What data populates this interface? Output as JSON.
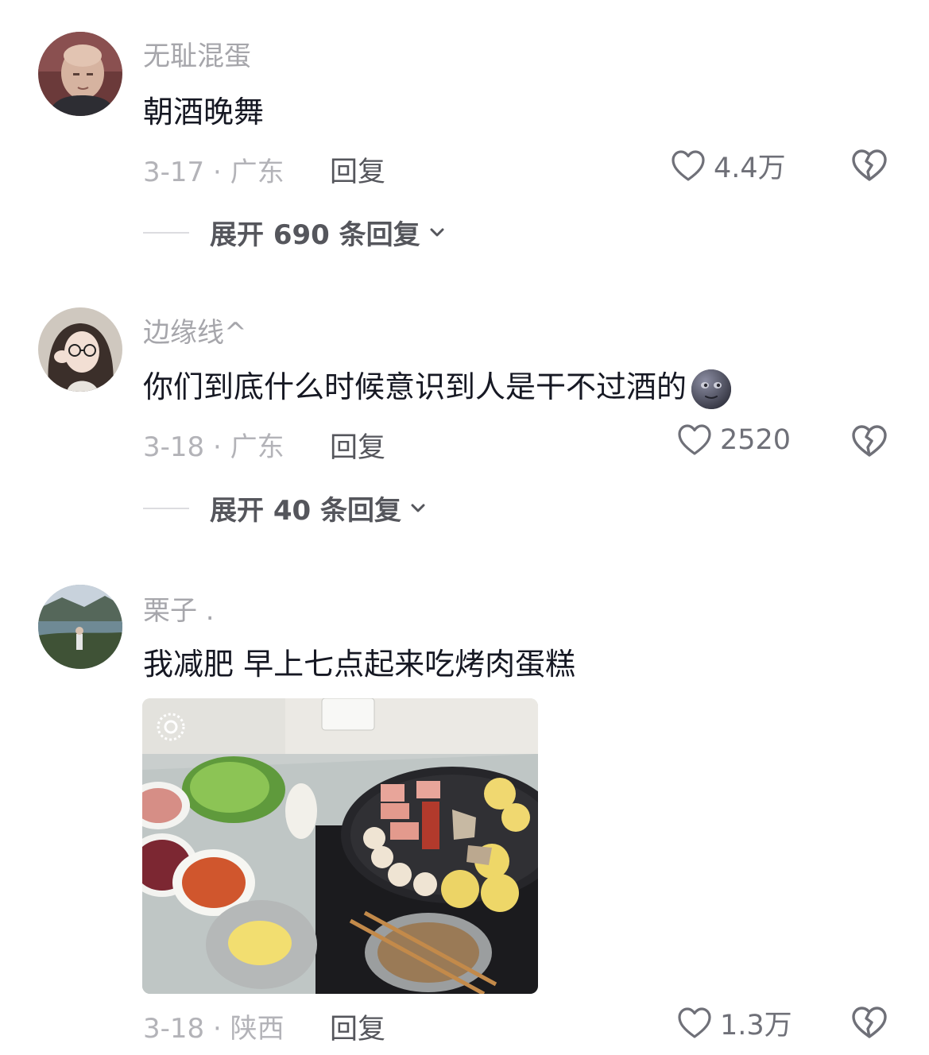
{
  "comments": [
    {
      "username": "无耻混蛋",
      "text": "朝酒晚舞",
      "meta": "3-17 · 广东",
      "reply_label": "回复",
      "likes": "4.4万",
      "expand_label": "展开 690 条回复"
    },
    {
      "username": "边缘线^",
      "text": "你们到底什么时候意识到人是干不过酒的",
      "emoji": "new-moon-face-emoji",
      "meta": "3-18 · 广东",
      "reply_label": "回复",
      "likes": "2520",
      "expand_label": "展开 40 条回复"
    },
    {
      "username": "栗子 .",
      "text": "我减肥 早上七点起来吃烤肉蛋糕",
      "image": "bbq-breakfast-photo",
      "meta": "3-18 · 陕西",
      "reply_label": "回复",
      "likes": "1.3万"
    }
  ],
  "icons": {
    "like": "heart-outline-icon",
    "dislike": "broken-heart-icon",
    "expand": "chevron-down-icon"
  },
  "colors": {
    "username": "#a6a6ab",
    "text": "#161823",
    "meta": "#b3b3b8",
    "action": "#55565c"
  }
}
